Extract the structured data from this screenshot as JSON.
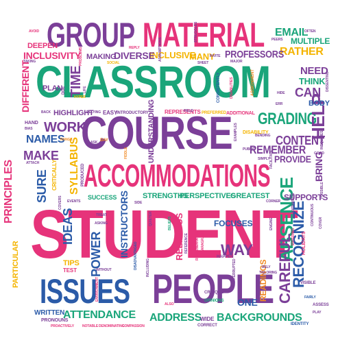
{
  "palette": {
    "pink": "#e6337a",
    "purple": "#7b3f98",
    "green": "#1aa57a",
    "blue": "#2b5ba8",
    "orange": "#f08a24",
    "yellow": "#f4b400"
  },
  "words": [
    {
      "text": "STUDENT",
      "color": "#e6337a",
      "orient": "h"
    },
    {
      "text": "CLASSROOM",
      "color": "#1aa57a",
      "orient": "h"
    },
    {
      "text": "COURSE",
      "color": "#7b3f98",
      "orient": "h"
    },
    {
      "text": "ACCOMMODATIONS",
      "color": "#e6337a",
      "orient": "h"
    },
    {
      "text": "PEOPLE",
      "color": "#7b3f98",
      "orient": "h"
    },
    {
      "text": "ISSUES",
      "color": "#2b5ba8",
      "orient": "h"
    },
    {
      "text": "GROUP",
      "color": "#7b3f98",
      "orient": "h"
    },
    {
      "text": "MATERIAL",
      "color": "#e6337a",
      "orient": "h"
    },
    {
      "text": "GRADING",
      "color": "#1aa57a",
      "orient": "h"
    },
    {
      "text": "HELP",
      "color": "#7b3f98",
      "orient": "v"
    },
    {
      "text": "TIME",
      "color": "#7b3f98",
      "orient": "v"
    },
    {
      "text": "ABSENCE",
      "color": "#1aa57a",
      "orient": "v"
    },
    {
      "text": "RECOGNIZE",
      "color": "#2b5ba8",
      "orient": "v"
    },
    {
      "text": "CAREFUL",
      "color": "#7b3f98",
      "orient": "v"
    },
    {
      "text": "WORK",
      "color": "#7b3f98",
      "orient": "h"
    },
    {
      "text": "CONTENT",
      "color": "#7b3f98",
      "orient": "h"
    },
    {
      "text": "REMEMBER",
      "color": "#7b3f98",
      "orient": "h"
    },
    {
      "text": "PROVIDE",
      "color": "#7b3f98",
      "orient": "h"
    },
    {
      "text": "BRING",
      "color": "#7b3f98",
      "orient": "v"
    },
    {
      "text": "SYLLABUS",
      "color": "#f4b400",
      "orient": "v"
    },
    {
      "text": "SURE",
      "color": "#2b5ba8",
      "orient": "v"
    },
    {
      "text": "MAKE",
      "color": "#7b3f98",
      "orient": "h"
    },
    {
      "text": "NAMES",
      "color": "#2b5ba8",
      "orient": "h"
    },
    {
      "text": "PRINCIPLES",
      "color": "#e6337a",
      "orient": "v"
    },
    {
      "text": "IDEAS",
      "color": "#2b5ba8",
      "orient": "v"
    },
    {
      "text": "POWER",
      "color": "#2b5ba8",
      "orient": "v"
    },
    {
      "text": "INSTRUCTORS",
      "color": "#2b5ba8",
      "orient": "v"
    },
    {
      "text": "WAY",
      "color": "#7b3f98",
      "orient": "h"
    },
    {
      "text": "FOCUSES",
      "color": "#2b5ba8",
      "orient": "h"
    },
    {
      "text": "ATTENDANCE",
      "color": "#1aa57a",
      "orient": "h"
    },
    {
      "text": "ADDRESS",
      "color": "#1aa57a",
      "orient": "h"
    },
    {
      "text": "BACKGROUNDS",
      "color": "#1aa57a",
      "orient": "h"
    },
    {
      "text": "ONE",
      "color": "#2b5ba8",
      "orient": "h"
    },
    {
      "text": "EMAIL",
      "color": "#1aa57a",
      "orient": "h"
    },
    {
      "text": "MULTIPLE",
      "color": "#1aa57a",
      "orient": "h"
    },
    {
      "text": "RATHER",
      "color": "#f4b400",
      "orient": "h"
    },
    {
      "text": "NEED",
      "color": "#7b3f98",
      "orient": "h"
    },
    {
      "text": "THINK",
      "color": "#1aa57a",
      "orient": "h"
    },
    {
      "text": "CAN",
      "color": "#7b3f98",
      "orient": "h"
    },
    {
      "text": "BODY",
      "color": "#2b5ba8",
      "orient": "h"
    },
    {
      "text": "PROFESSORS",
      "color": "#7b3f98",
      "orient": "h"
    },
    {
      "text": "INCLUSIVE",
      "color": "#f4b400",
      "orient": "h"
    },
    {
      "text": "MANY",
      "color": "#f4b400",
      "orient": "h"
    },
    {
      "text": "MAKING",
      "color": "#7b3f98",
      "orient": "h"
    },
    {
      "text": "DIVERSE",
      "color": "#7b3f98",
      "orient": "h"
    },
    {
      "text": "INCLUSIVITY",
      "color": "#e6337a",
      "orient": "h"
    },
    {
      "text": "DEEPEN",
      "color": "#e6337a",
      "orient": "h"
    },
    {
      "text": "PLAN",
      "color": "#7b3f98",
      "orient": "h"
    },
    {
      "text": "HIGHLIGHT",
      "color": "#7b3f98",
      "orient": "h"
    },
    {
      "text": "EASY",
      "color": "#7b3f98",
      "orient": "h"
    },
    {
      "text": "SUCCESS",
      "color": "#1aa57a",
      "orient": "h"
    },
    {
      "text": "STRENGTHS",
      "color": "#1aa57a",
      "orient": "h"
    },
    {
      "text": "PERSPECTIVES",
      "color": "#1aa57a",
      "orient": "h"
    },
    {
      "text": "GREATEST",
      "color": "#1aa57a",
      "orient": "h"
    },
    {
      "text": "SUPPORTS",
      "color": "#7b3f98",
      "orient": "h"
    },
    {
      "text": "TIPS",
      "color": "#f4b400",
      "orient": "h"
    },
    {
      "text": "TEST",
      "color": "#e6337a",
      "orient": "h"
    },
    {
      "text": "WRITTEN",
      "color": "#2b5ba8",
      "orient": "h"
    },
    {
      "text": "READINGS",
      "color": "#f08a24",
      "orient": "v"
    },
    {
      "text": "DIFFERENT",
      "color": "#e6337a",
      "orient": "v"
    },
    {
      "text": "UNDERSTANDING",
      "color": "#7b3f98",
      "orient": "v"
    },
    {
      "text": "RELIGIOUS",
      "color": "#e6337a",
      "orient": "v"
    },
    {
      "text": "PARTICULAR",
      "color": "#f4b400",
      "orient": "v"
    },
    {
      "text": "DISABILITY",
      "color": "#f4b400",
      "orient": "h"
    },
    {
      "text": "REPRESENTS",
      "color": "#e6337a",
      "orient": "h"
    },
    {
      "text": "ADDITIONAL",
      "color": "#e6337a",
      "orient": "h"
    },
    {
      "text": "INTRODUCTORY",
      "color": "#7b3f98",
      "orient": "h"
    },
    {
      "text": "PREFERRED",
      "color": "#f4b400",
      "orient": "h"
    },
    {
      "text": "ASSIGNMENT",
      "color": "#f08a24",
      "orient": "v"
    },
    {
      "text": "CONSISTENTLY",
      "color": "#2b5ba8",
      "orient": "v"
    },
    {
      "text": "HOLIDAYS",
      "color": "#e6337a",
      "orient": "v"
    },
    {
      "text": "CONTINUOUS",
      "color": "#7b3f98",
      "orient": "v"
    },
    {
      "text": "HAPPEN",
      "color": "#7b3f98",
      "orient": "h"
    },
    {
      "text": "IDENTITY",
      "color": "#2b5ba8",
      "orient": "h"
    },
    {
      "text": "ASSESS",
      "color": "#7b3f98",
      "orient": "h"
    },
    {
      "text": "CRITIQUE",
      "color": "#7b3f98",
      "orient": "h"
    },
    {
      "text": "OPINIONS",
      "color": "#1aa57a",
      "orient": "h"
    },
    {
      "text": "WIDE",
      "color": "#7b3f98",
      "orient": "h"
    },
    {
      "text": "CORRECT",
      "color": "#7b3f98",
      "orient": "h"
    },
    {
      "text": "PRONOUNS",
      "color": "#7b3f98",
      "orient": "h"
    },
    {
      "text": "PROACTIVELY",
      "color": "#e6337a",
      "orient": "h"
    },
    {
      "text": "NOTABLE",
      "color": "#e6337a",
      "orient": "h"
    },
    {
      "text": "DENOMINATING",
      "color": "#e6337a",
      "orient": "h"
    },
    {
      "text": "COMPASSION",
      "color": "#e6337a",
      "orient": "h"
    },
    {
      "text": "VISIBLE",
      "color": "#7b3f98",
      "orient": "h"
    },
    {
      "text": "FAIRLY",
      "color": "#2b5ba8",
      "orient": "h"
    },
    {
      "text": "CORNER",
      "color": "#7b3f98",
      "orient": "h"
    },
    {
      "text": "EVENTS",
      "color": "#7b3f98",
      "orient": "h"
    },
    {
      "text": "ASKING",
      "color": "#7b3f98",
      "orient": "h"
    },
    {
      "text": "TREAT",
      "color": "#7b3f98",
      "orient": "h"
    },
    {
      "text": "WITHOUT",
      "color": "#7b3f98",
      "orient": "h"
    },
    {
      "text": "ALSO",
      "color": "#e6337a",
      "orient": "h"
    },
    {
      "text": "AVOID",
      "color": "#e6337a",
      "orient": "h"
    },
    {
      "text": "OFTEN",
      "color": "#7b3f98",
      "orient": "h"
    },
    {
      "text": "PEERS",
      "color": "#7b3f98",
      "orient": "h"
    },
    {
      "text": "HIDE",
      "color": "#7b3f98",
      "orient": "h"
    },
    {
      "text": "ERR",
      "color": "#7b3f98",
      "orient": "h"
    },
    {
      "text": "GOOD",
      "color": "#7b3f98",
      "orient": "h"
    },
    {
      "text": "SIMPLY",
      "color": "#7b3f98",
      "orient": "h"
    },
    {
      "text": "PUBLIC",
      "color": "#7b3f98",
      "orient": "h"
    },
    {
      "text": "BENDING",
      "color": "#7b3f98",
      "orient": "h"
    },
    {
      "text": "HAND",
      "color": "#7b3f98",
      "orient": "h"
    },
    {
      "text": "BIAS",
      "color": "#7b3f98",
      "orient": "h"
    },
    {
      "text": "BACK",
      "color": "#7b3f98",
      "orient": "h"
    },
    {
      "text": "RANGE",
      "color": "#f08a24",
      "orient": "h"
    },
    {
      "text": "ASK",
      "color": "#7b3f98",
      "orient": "h"
    },
    {
      "text": "DAY",
      "color": "#f08a24",
      "orient": "h"
    },
    {
      "text": "TAKING",
      "color": "#7b3f98",
      "orient": "h"
    },
    {
      "text": "SOCIAL",
      "color": "#f4b400",
      "orient": "h"
    },
    {
      "text": "SHEET",
      "color": "#7b3f98",
      "orient": "h"
    },
    {
      "text": "INVITE",
      "color": "#7b3f98",
      "orient": "h"
    },
    {
      "text": "MAJOR",
      "color": "#7b3f98",
      "orient": "h"
    },
    {
      "text": "REPLY",
      "color": "#e6337a",
      "orient": "h"
    },
    {
      "text": "HYPER",
      "color": "#f4b400",
      "orient": "h"
    },
    {
      "text": "RELYING",
      "color": "#7b3f98",
      "orient": "h"
    },
    {
      "text": "ATTACH",
      "color": "#7b3f98",
      "orient": "h"
    },
    {
      "text": "CRITICALLY",
      "color": "#f4b400",
      "orient": "v"
    },
    {
      "text": "PRODUCED",
      "color": "#7b3f98",
      "orient": "v"
    },
    {
      "text": "PROBLEMS",
      "color": "#e6337a",
      "orient": "v"
    },
    {
      "text": "DUE",
      "color": "#7b3f98",
      "orient": "v"
    },
    {
      "text": "LIFE",
      "color": "#7b3f98",
      "orient": "v"
    },
    {
      "text": "FIDDLE",
      "color": "#f08a24",
      "orient": "v"
    },
    {
      "text": "INTERRUPTED",
      "color": "#7b3f98",
      "orient": "v"
    },
    {
      "text": "FACILITATE",
      "color": "#7b3f98",
      "orient": "v"
    },
    {
      "text": "INEQUITIES",
      "color": "#7b3f98",
      "orient": "v"
    },
    {
      "text": "DISSENTING",
      "color": "#7b3f98",
      "orient": "v"
    },
    {
      "text": "DISABILITIES",
      "color": "#e6337a",
      "orient": "v"
    },
    {
      "text": "DISADVANTAGED",
      "color": "#2b5ba8",
      "orient": "v"
    },
    {
      "text": "REPRESENTATIVE",
      "color": "#e6337a",
      "orient": "v"
    },
    {
      "text": "REFERENCE",
      "color": "#7b3f98",
      "orient": "v"
    },
    {
      "text": "PARAGRAPH",
      "color": "#e6337a",
      "orient": "v"
    },
    {
      "text": "BELIEFS",
      "color": "#1aa57a",
      "orient": "v"
    },
    {
      "text": "ENGINE",
      "color": "#7b3f98",
      "orient": "v"
    },
    {
      "text": "POSSIBLE",
      "color": "#7b3f98",
      "orient": "v"
    },
    {
      "text": "COVER",
      "color": "#7b3f98",
      "orient": "v"
    },
    {
      "text": "COVERS",
      "color": "#7b3f98",
      "orient": "v"
    },
    {
      "text": "INCLUDING",
      "color": "#7b3f98",
      "orient": "v"
    },
    {
      "text": "ENTERING",
      "color": "#e6337a",
      "orient": "v"
    },
    {
      "text": "ENVIRONMENT",
      "color": "#e6337a",
      "orient": "v"
    },
    {
      "text": "PLAY",
      "color": "#7b3f98",
      "orient": "h"
    },
    {
      "text": "TAILORING",
      "color": "#7b3f98",
      "orient": "h"
    },
    {
      "text": "RELY",
      "color": "#7b3f98",
      "orient": "h"
    },
    {
      "text": "FIELD",
      "color": "#7b3f98",
      "orient": "h"
    },
    {
      "text": "ASSUMPTIONS",
      "color": "#7b3f98",
      "orient": "v"
    },
    {
      "text": "STRUGGLES",
      "color": "#7b3f98",
      "orient": "v"
    },
    {
      "text": "EXAMPLES",
      "color": "#7b3f98",
      "orient": "v"
    },
    {
      "text": "QUIETER",
      "color": "#7b3f98",
      "orient": "v"
    },
    {
      "text": "EXTENSION",
      "color": "#7b3f98",
      "orient": "v"
    },
    {
      "text": "SIDE",
      "color": "#7b3f98",
      "orient": "h"
    }
  ]
}
